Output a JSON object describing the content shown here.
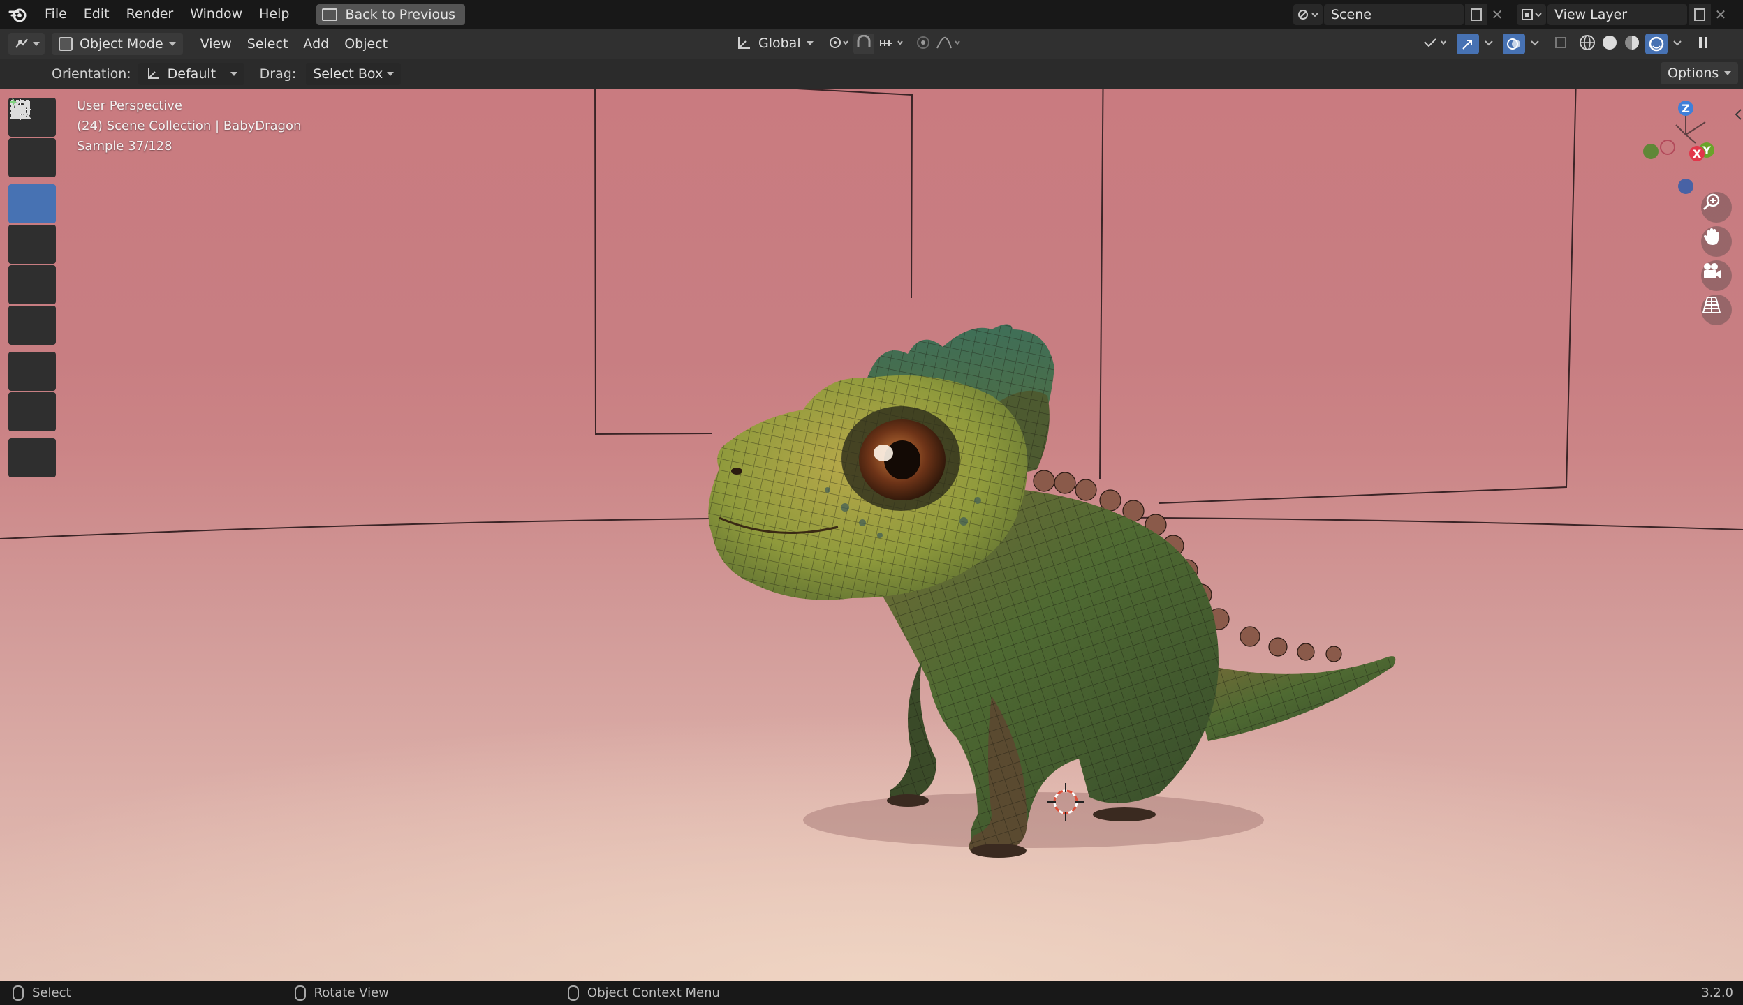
{
  "topbar": {
    "menus": [
      "File",
      "Edit",
      "Render",
      "Window",
      "Help"
    ],
    "back_button": "Back to Previous",
    "scene_label": "Scene",
    "view_layer_label": "View Layer"
  },
  "header": {
    "mode": "Object Mode",
    "menus": [
      "View",
      "Select",
      "Add",
      "Object"
    ],
    "transform_orientation": "Global"
  },
  "tool_settings": {
    "orientation_label": "Orientation:",
    "orientation_value": "Default",
    "drag_label": "Drag:",
    "drag_value": "Select Box",
    "options_label": "Options"
  },
  "viewport": {
    "view_name": "User Perspective",
    "collection_info": "(24) Scene Collection | BabyDragon",
    "sample_info": "Sample 37/128",
    "gizmo_axes": {
      "z": "Z",
      "x": "X",
      "y": "Y"
    },
    "colors": {
      "bg_top": "#c97b80",
      "bg_floor": "#e3c1b5",
      "dragon_head": "#8f9a3c",
      "dragon_body": "#4f6a32"
    }
  },
  "toolbar": {
    "tools": [
      "select-box-icon",
      "cursor-icon",
      "move-icon",
      "rotate-icon",
      "scale-icon",
      "transform-icon",
      "annotate-icon",
      "measure-icon",
      "add-cube-icon"
    ],
    "active": "move-icon"
  },
  "statusbar": {
    "select": "Select",
    "rotate": "Rotate View",
    "context_menu": "Object Context Menu",
    "version": "3.2.0"
  }
}
